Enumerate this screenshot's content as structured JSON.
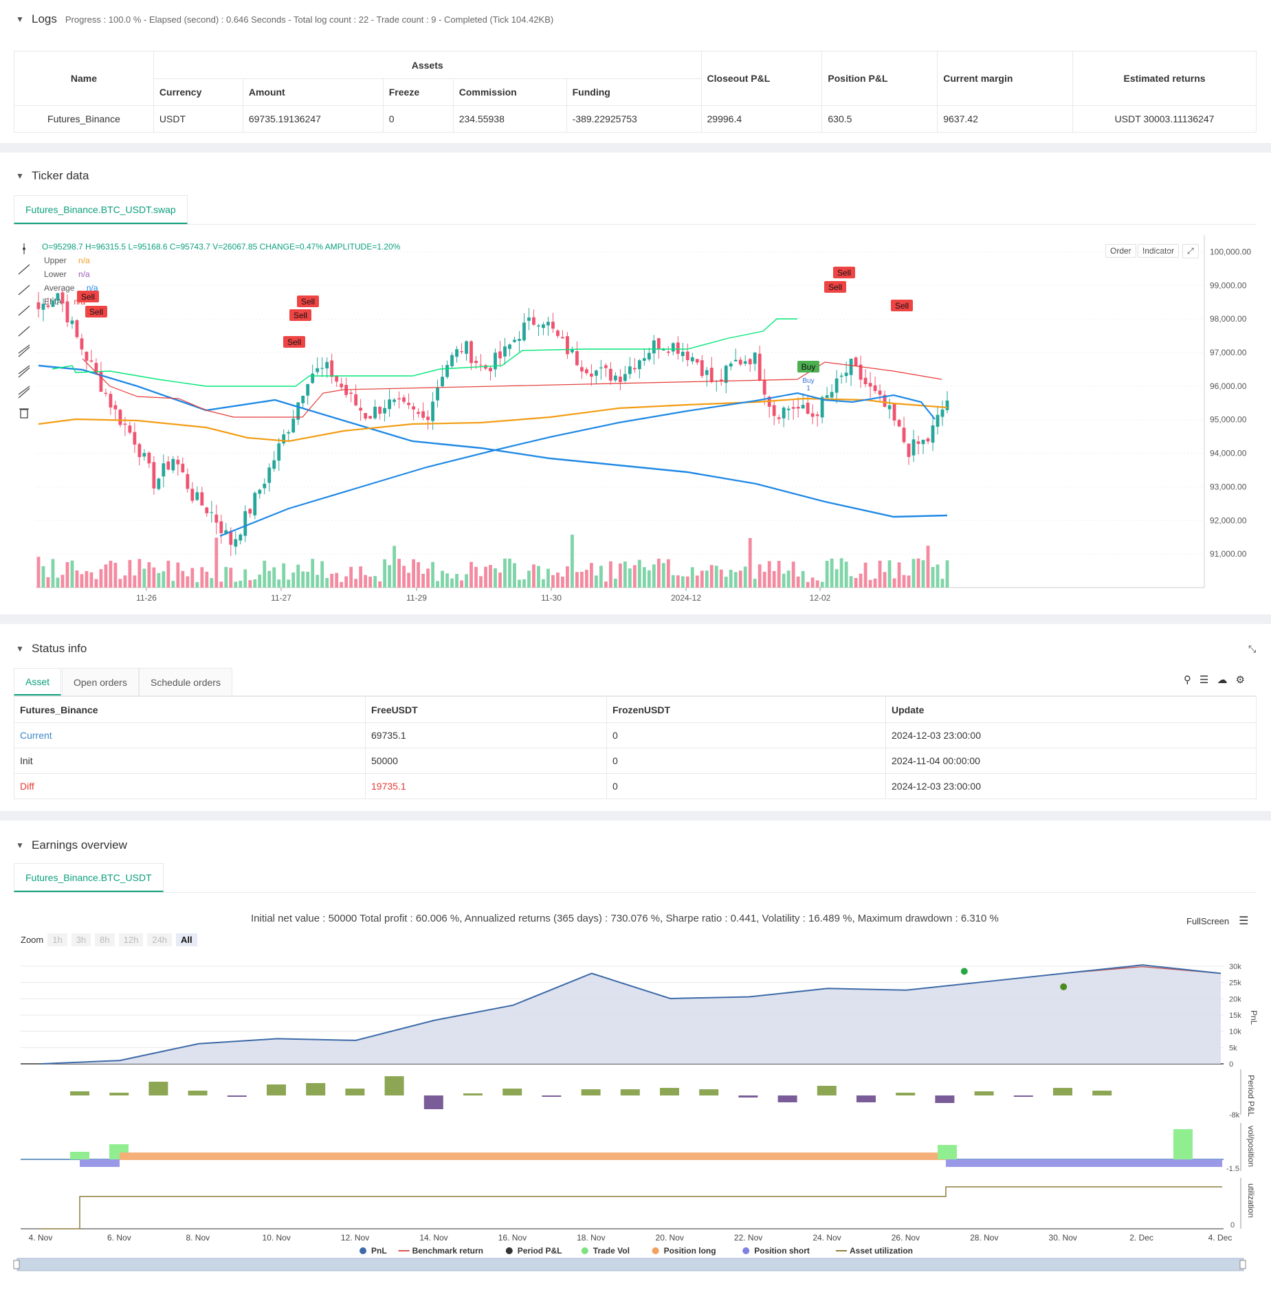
{
  "logs": {
    "title": "Logs",
    "summary": "Progress : 100.0 % - Elapsed (second) : 0.646  Seconds - Total log count : 22 - Trade count : 9 - Completed (Tick 104.42KB)",
    "table": {
      "h_name": "Name",
      "h_assets": "Assets",
      "h_currency": "Currency",
      "h_amount": "Amount",
      "h_freeze": "Freeze",
      "h_commission": "Commission",
      "h_funding": "Funding",
      "h_closeout": "Closeout P&L",
      "h_position": "Position P&L",
      "h_margin": "Current margin",
      "h_returns": "Estimated returns",
      "row": {
        "name": "Futures_Binance",
        "currency": "USDT",
        "amount": "69735.19136247",
        "freeze": "0",
        "commission": "234.55938",
        "funding": "-389.22925753",
        "closeout": "29996.4",
        "position": "630.5",
        "margin": "9637.42",
        "returns": "USDT 30003.11136247"
      }
    }
  },
  "ticker": {
    "title": "Ticker data",
    "tab": "Futures_Binance.BTC_USDT.swap",
    "ohlc": "O=95298.7 H=96315.5 L=95168.6 C=95743.7 V=26067.85 CHANGE=0.47% AMPLITUDE=1.20%",
    "legend": [
      {
        "name": "Upper",
        "value": "n/a",
        "color": "#f0a020"
      },
      {
        "name": "Lower",
        "value": "n/a",
        "color": "#9b59b6"
      },
      {
        "name": "Average",
        "value": "n/a",
        "color": "#1e88e5"
      },
      {
        "name": "EMA",
        "value": "n/a",
        "color": "#e53935"
      }
    ],
    "btn_order": "Order",
    "btn_indicator": "Indicator",
    "price_ticks": [
      "100,000.00",
      "99,000.00",
      "98,000.00",
      "97,000.00",
      "96,000.00",
      "95,000.00",
      "94,000.00",
      "93,000.00",
      "92,000.00",
      "91,000.00"
    ],
    "date_ticks": [
      "11-26",
      "11-27",
      "11-29",
      "11-30",
      "2024-12",
      "12-02"
    ],
    "signals": [
      {
        "label": "Sell",
        "kind": "sell"
      },
      {
        "label": "Sell",
        "kind": "sell"
      },
      {
        "label": "Sell",
        "kind": "sell"
      },
      {
        "label": "Sell",
        "kind": "sell"
      },
      {
        "label": "Sell",
        "kind": "sell"
      },
      {
        "label": "Sell",
        "kind": "sell"
      },
      {
        "label": "Sell",
        "kind": "sell"
      },
      {
        "label": "Sell",
        "kind": "sell"
      },
      {
        "label": "Buy",
        "kind": "buy"
      }
    ],
    "buy_note": "Buy",
    "buy_note2": "1"
  },
  "status": {
    "title": "Status info",
    "tabs": [
      "Asset",
      "Open orders",
      "Schedule orders"
    ],
    "headers": [
      "Futures_Binance",
      "FreeUSDT",
      "FrozenUSDT",
      "Update"
    ],
    "rows": [
      {
        "label": "Current",
        "free": "69735.1",
        "frozen": "0",
        "update": "2024-12-03 23:00:00"
      },
      {
        "label": "Init",
        "free": "50000",
        "frozen": "0",
        "update": "2024-11-04 00:00:00"
      },
      {
        "label": "Diff",
        "free": "19735.1",
        "frozen": "0",
        "update": "2024-12-03 23:00:00"
      }
    ]
  },
  "earnings": {
    "title": "Earnings overview",
    "tab": "Futures_Binance.BTC_USDT",
    "summary": "Initial net value : 50000  Total profit : 60.006 %, Annualized returns (365 days) : 730.076 %, Sharpe ratio : 0.441, Volatility : 16.489 %, Maximum drawdown : 6.310 %",
    "fullscreen": "FullScreen",
    "zoom_label": "Zoom",
    "zoom_buttons": [
      "1h",
      "3h",
      "8h",
      "12h",
      "24h",
      "All"
    ],
    "pnl_ticks": [
      "30k",
      "25k",
      "20k",
      "15k",
      "10k",
      "5k",
      "0"
    ],
    "period_tick": "-8k",
    "vol_tick": "-1.5",
    "util_tick": "0",
    "axis_pnl": "PnL",
    "axis_period": "Period P&L",
    "axis_vol": "vol/position",
    "axis_util": "utilization",
    "date_ticks": [
      "4. Nov",
      "6. Nov",
      "8. Nov",
      "10. Nov",
      "12. Nov",
      "14. Nov",
      "16. Nov",
      "18. Nov",
      "20. Nov",
      "22. Nov",
      "24. Nov",
      "26. Nov",
      "28. Nov",
      "30. Nov",
      "2. Dec",
      "4. Dec"
    ],
    "legend": [
      {
        "name": "PnL",
        "color": "#3d6aa8",
        "shape": "dot"
      },
      {
        "name": "Benchmark return",
        "color": "#d9534f",
        "shape": "line"
      },
      {
        "name": "Period P&L",
        "color": "#333333",
        "shape": "dot"
      },
      {
        "name": "Trade Vol",
        "color": "#7ee07e",
        "shape": "dot"
      },
      {
        "name": "Position long",
        "color": "#f0a060",
        "shape": "dot"
      },
      {
        "name": "Position short",
        "color": "#8080e0",
        "shape": "dot"
      },
      {
        "name": "Asset utilization",
        "color": "#8b7d3a",
        "shape": "line"
      }
    ]
  },
  "chart_data": [
    {
      "type": "candlestick",
      "title": "",
      "ylim": [
        90000,
        100500
      ],
      "x_ticks": [
        "11-26",
        "11-27",
        "11-29",
        "11-30",
        "2024-12",
        "12-02"
      ],
      "y_ticks": [
        91000,
        92000,
        93000,
        94000,
        95000,
        96000,
        97000,
        98000,
        99000,
        100000
      ],
      "close_path": [
        98300,
        98800,
        97400,
        96300,
        95200,
        94400,
        93100,
        93900,
        92700,
        92200,
        91300,
        92400,
        93600,
        94900,
        96400,
        96500,
        95700,
        95100,
        95500,
        95300,
        95000,
        96600,
        97200,
        96500,
        96900,
        97700,
        98100,
        97300,
        96700,
        96400,
        96300,
        96800,
        97300,
        97200,
        96800,
        96000,
        96700,
        96900,
        95200,
        95400,
        95100,
        95800,
        96600,
        95900,
        95200,
        94100,
        94400,
        95600
      ]
    },
    {
      "type": "line",
      "title": "",
      "x": [
        "4. Nov",
        "6. Nov",
        "8. Nov",
        "10. Nov",
        "12. Nov",
        "14. Nov",
        "16. Nov",
        "18. Nov",
        "20. Nov",
        "22. Nov",
        "24. Nov",
        "26. Nov",
        "28. Nov",
        "30. Nov",
        "2. Dec",
        "4. Dec"
      ],
      "series": [
        {
          "name": "PnL",
          "values": [
            0,
            1000,
            6000,
            7500,
            7000,
            13000,
            17500,
            27000,
            19500,
            20000,
            22500,
            22000,
            24500,
            27000,
            29500,
            27000
          ]
        },
        {
          "name": "Benchmark return",
          "values": [
            0,
            1000,
            6000,
            7500,
            7000,
            13000,
            17500,
            27000,
            19500,
            20000,
            22500,
            22000,
            24500,
            27000,
            29000,
            27000
          ]
        }
      ],
      "ylim": [
        0,
        32000
      ]
    }
  ]
}
